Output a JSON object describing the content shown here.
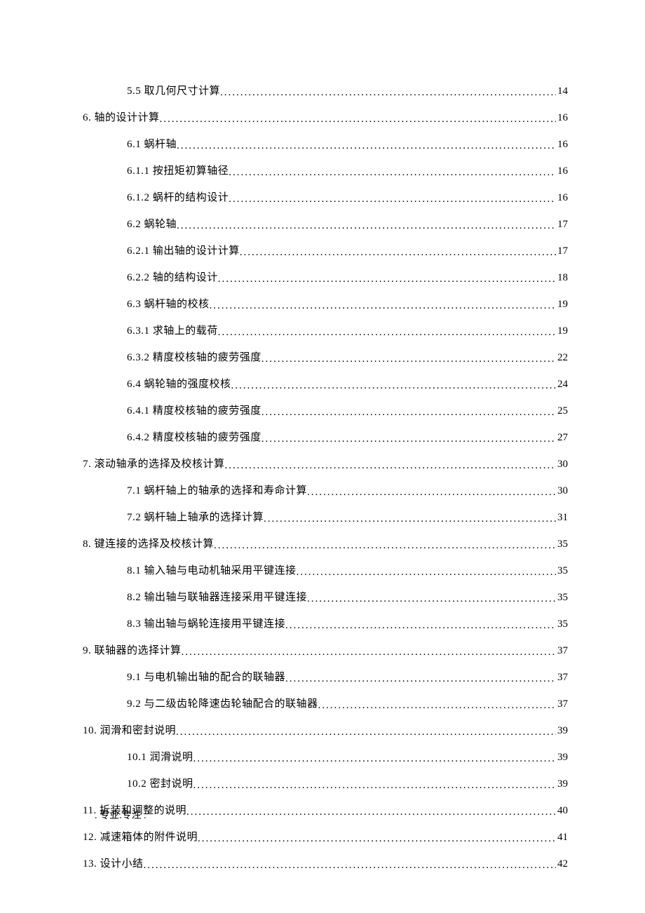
{
  "toc": [
    {
      "label": "5.5 取几何尺寸计算",
      "page": "14",
      "indent": 1
    },
    {
      "label": "6.  轴的设计计算",
      "page": "16",
      "indent": 0
    },
    {
      "label": "6.1 蜗杆轴",
      "page": "16",
      "indent": 1
    },
    {
      "label": "6.1.1 按扭矩初算轴径",
      "page": "16",
      "indent": 1
    },
    {
      "label": "6.1.2 蜗杆的结构设计",
      "page": "16",
      "indent": 1
    },
    {
      "label": "6.2 蜗轮轴",
      "page": "17",
      "indent": 1
    },
    {
      "label": "6.2.1 输出轴的设计计算",
      "page": "17",
      "indent": 1
    },
    {
      "label": "6.2.2 轴的结构设计",
      "page": "18",
      "indent": 1
    },
    {
      "label": "6.3 蜗杆轴的校核",
      "page": "19",
      "indent": 1
    },
    {
      "label": "6.3.1 求轴上的载荷",
      "page": "19",
      "indent": 1
    },
    {
      "label": "6.3.2 精度校核轴的疲劳强度",
      "page": "22",
      "indent": 1
    },
    {
      "label": "6.4 蜗轮轴的强度校核",
      "page": "24",
      "indent": 1
    },
    {
      "label": "6.4.1 精度校核轴的疲劳强度",
      "page": "25",
      "indent": 1
    },
    {
      "label": "6.4.2 精度校核轴的疲劳强度",
      "page": "27",
      "indent": 1
    },
    {
      "label": "7. 滚动轴承的选择及校核计算",
      "page": "30",
      "indent": 0
    },
    {
      "label": "7.1 蜗杆轴上的轴承的选择和寿命计算",
      "page": "30",
      "indent": 1
    },
    {
      "label": "7.2 蜗杆轴上轴承的选择计算",
      "page": "31",
      "indent": 1
    },
    {
      "label": "8. 键连接的选择及校核计算",
      "page": "35",
      "indent": 0
    },
    {
      "label": "8.1 输入轴与电动机轴采用平键连接",
      "page": "35",
      "indent": 1
    },
    {
      "label": "8.2 输出轴与联轴器连接采用平键连接",
      "page": "35",
      "indent": 1
    },
    {
      "label": "8.3 输出轴与蜗轮连接用平键连接",
      "page": "35",
      "indent": 1
    },
    {
      "label": "9.  联轴器的选择计算",
      "page": "37",
      "indent": 0
    },
    {
      "label": "9.1 与电机输出轴的配合的联轴器",
      "page": "37",
      "indent": 1
    },
    {
      "label": "9.2 与二级齿轮降速齿轮轴配合的联轴器",
      "page": "37",
      "indent": 1
    },
    {
      "label": "10. 润滑和密封说明",
      "page": "39",
      "indent": 0
    },
    {
      "label": "10.1 润滑说明",
      "page": "39",
      "indent": 1
    },
    {
      "label": "10.2 密封说明",
      "page": "39",
      "indent": 1
    },
    {
      "label": "11.  拆装和调整的说明",
      "page": "40",
      "indent": 0
    },
    {
      "label": "12.  减速箱体的附件说明",
      "page": "41",
      "indent": 0
    },
    {
      "label": "13. 设计小结",
      "page": "42",
      "indent": 0
    }
  ],
  "footer": ". 专业.专注 ."
}
